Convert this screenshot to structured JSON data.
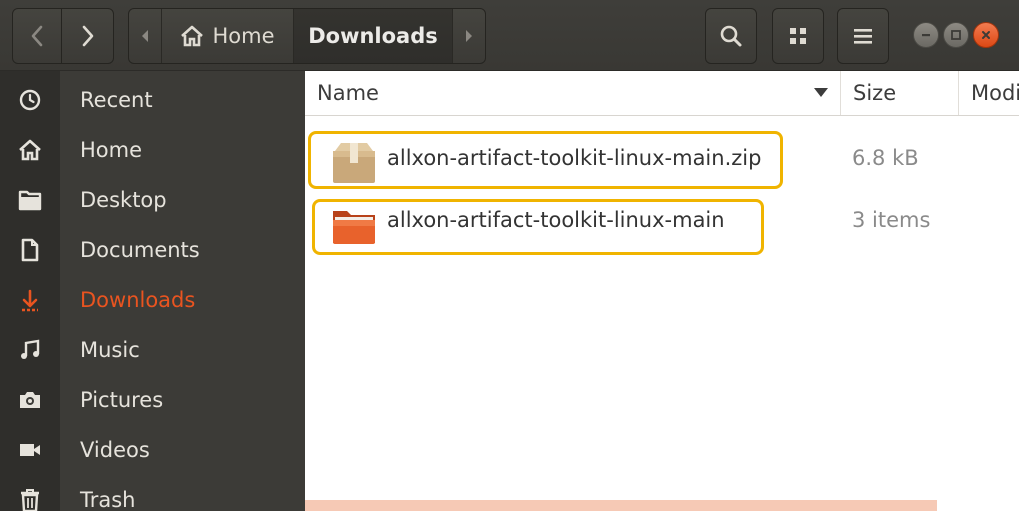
{
  "window": {
    "title": "Downloads"
  },
  "header": {
    "path": [
      {
        "label": "Home",
        "icon": "home-icon"
      },
      {
        "label": "Downloads"
      }
    ]
  },
  "sidebar": {
    "items": [
      {
        "label": "Recent",
        "icon": "clock-icon"
      },
      {
        "label": "Home",
        "icon": "home-icon"
      },
      {
        "label": "Desktop",
        "icon": "folder-icon"
      },
      {
        "label": "Documents",
        "icon": "document-icon"
      },
      {
        "label": "Downloads",
        "icon": "download-icon",
        "active": true
      },
      {
        "label": "Music",
        "icon": "music-icon"
      },
      {
        "label": "Pictures",
        "icon": "camera-icon"
      },
      {
        "label": "Videos",
        "icon": "video-icon"
      },
      {
        "label": "Trash",
        "icon": "trash-icon"
      }
    ]
  },
  "list": {
    "columns": [
      "Name",
      "Size",
      "Modified"
    ],
    "rows": [
      {
        "name": "allxon-artifact-toolkit-linux-main.zip",
        "size": "6.8 kB",
        "icon": "archive-icon"
      },
      {
        "name": "allxon-artifact-toolkit-linux-main",
        "size": "3 items",
        "icon": "folder-icon"
      }
    ]
  },
  "colors": {
    "accent": "#e95420",
    "highlight": "#f0b400"
  }
}
